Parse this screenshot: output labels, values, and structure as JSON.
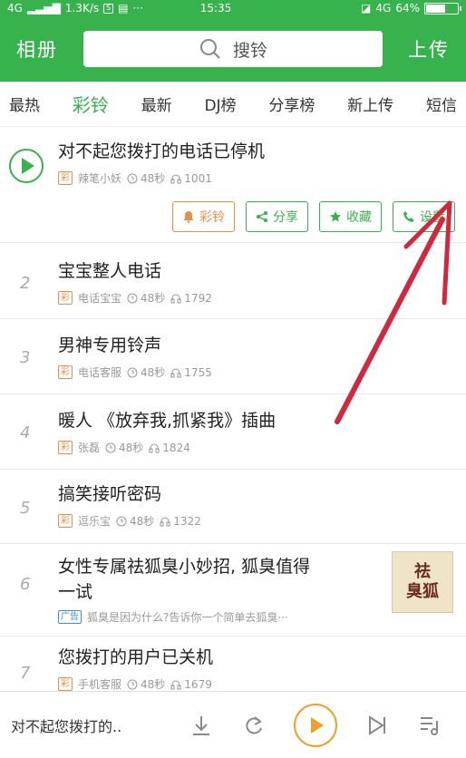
{
  "status_bar": {
    "network": "4G",
    "speed": "1.3K/s",
    "icon1": "S",
    "more": "···",
    "time": "15:35",
    "network_right": "4G",
    "battery_text": "64%",
    "battery_level": 0.64
  },
  "header": {
    "left_label": "相册",
    "search_placeholder": "搜铃",
    "right_label": "上传"
  },
  "tabs": [
    "最热",
    "彩铃",
    "最新",
    "DJ榜",
    "分享榜",
    "新上传",
    "短信"
  ],
  "active_tab_index": 1,
  "songs": [
    {
      "number": "",
      "title": "对不起您拨打的电话已停机",
      "tag": "彩",
      "author": "辣笔小妖",
      "duration": "48秒",
      "plays": "1001"
    },
    {
      "number": "2",
      "title": "宝宝整人电话",
      "tag": "彩",
      "author": "电话宝宝",
      "duration": "48秒",
      "plays": "1792"
    },
    {
      "number": "3",
      "title": "男神专用铃声",
      "tag": "彩",
      "author": "电话客服",
      "duration": "48秒",
      "plays": "1755"
    },
    {
      "number": "4",
      "title": "暖人 《放弃我,抓紧我》插曲",
      "tag": "彩",
      "author": "张磊",
      "duration": "48秒",
      "plays": "1824"
    },
    {
      "number": "5",
      "title": "搞笑接听密码",
      "tag": "彩",
      "author": "逗乐宝",
      "duration": "48秒",
      "plays": "1322"
    },
    {
      "number": "6",
      "title_line1": "女性专属祛狐臭小妙招, 狐臭值得",
      "title_line2": "一试",
      "tag": "广告",
      "ad_text": "狐臭是因为什么?告诉你一个简单去狐臭···",
      "thumb_text1": "祛",
      "thumb_text2": "臭狐"
    },
    {
      "number": "7",
      "title": "您拨打的用户已关机",
      "tag": "彩",
      "author": "手机客服",
      "duration": "48秒",
      "plays": "1679"
    }
  ],
  "actions": {
    "ringtone": "彩铃",
    "share": "分享",
    "favorite": "收藏",
    "set": "设置"
  },
  "player": {
    "now_playing": "对不起您拨打的.."
  },
  "colors": {
    "primary": "#37b24d",
    "accent_orange": "#e8904a",
    "play_orange": "#f0a02a",
    "annotation": "#d0283f"
  }
}
